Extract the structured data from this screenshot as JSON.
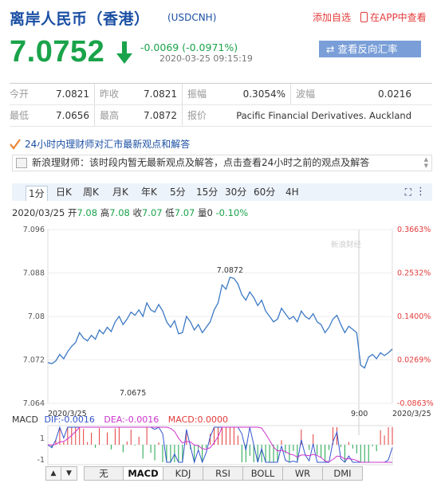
{
  "header": {
    "title": "离岸人民币（香港）",
    "code": "(USDCNH)",
    "add_watchlist": "添加自选",
    "app_view": "在APP中查看"
  },
  "quote": {
    "price": "7.0752",
    "direction": "down",
    "change": "-0.0069 (-0.0971%)",
    "timestamp": "2020-03-25 09:15:19",
    "reverse_button": "查看反向汇率"
  },
  "stats": {
    "row1": [
      {
        "label": "今开",
        "value": "7.0821"
      },
      {
        "label": "昨收",
        "value": "7.0821"
      },
      {
        "label": "振幅",
        "value": "0.3054%"
      },
      {
        "label": "波幅",
        "value": "0.0216"
      }
    ],
    "row2": [
      {
        "label": "最低",
        "value": "7.0656"
      },
      {
        "label": "最高",
        "value": "7.0872"
      },
      {
        "label": "报价",
        "value": "Pacific Financial Derivatives. Auckland"
      }
    ]
  },
  "commentary": {
    "banner": "24小时内理财师对汇市最新观点和解答",
    "text": "新浪理财师：该时段内暂无最新观点及解答，点击查看24小时之前的观点及解答"
  },
  "period_tabs": [
    "1分",
    "日K",
    "周K",
    "月K",
    "年K",
    "5分",
    "15分",
    "30分",
    "60分",
    "4H"
  ],
  "period_active": "1分",
  "ohlc": {
    "date": "2020/03/25",
    "open_label": "开",
    "open": "7.08",
    "high_label": "高",
    "high": "7.08",
    "close_label": "收",
    "close": "7.07",
    "low_label": "低",
    "low": "7.07",
    "vol_label": "量",
    "vol": "0",
    "change_pct": "-0.10%"
  },
  "chart_data": {
    "type": "line",
    "y_ticks_left": [
      "7.096",
      "7.088",
      "7.08",
      "7.072",
      "7.064"
    ],
    "y_ticks_right": [
      "0.3663%",
      "0.2532%",
      "0.1400%",
      "0.0269%",
      "-0.0863%"
    ],
    "ylim": [
      7.064,
      7.096
    ],
    "x_labels": [
      "2020/3/25",
      "9:00",
      "2020/3/25"
    ],
    "annotation_high": "7.0872",
    "annotation_low": "7.0675",
    "watermark": "新浪财经",
    "series": [
      {
        "values": [
          7.0715,
          7.0713,
          7.0718,
          7.073,
          7.0722,
          7.0735,
          7.0745,
          7.0752,
          7.077,
          7.076,
          7.0755,
          7.0765,
          7.0758,
          7.0775,
          7.0768,
          7.078,
          7.0772,
          7.079,
          7.08,
          7.0785,
          7.0795,
          7.0808,
          7.0802,
          7.0812,
          7.08,
          7.0825,
          7.0812,
          7.0808,
          7.0822,
          7.081,
          7.079,
          7.078,
          7.0792,
          7.0768,
          7.077,
          7.08,
          7.079,
          7.0775,
          7.0785,
          7.077,
          7.078,
          7.079,
          7.0812,
          7.0825,
          7.0858,
          7.085,
          7.0872,
          7.087,
          7.086,
          7.084,
          7.083,
          7.0845,
          7.0835,
          7.082,
          7.083,
          7.081,
          7.08,
          7.079,
          7.0795,
          7.0815,
          7.0805,
          7.0795,
          7.08,
          7.079,
          7.081,
          7.08,
          7.0795,
          7.0805,
          7.079,
          7.0785,
          7.077,
          7.078,
          7.0795,
          7.0802,
          7.0785,
          7.077,
          7.0782,
          7.0776,
          7.077,
          7.071,
          7.0705,
          7.0725,
          7.073,
          7.0722,
          7.0733,
          7.0728,
          7.0733,
          7.074
        ]
      }
    ]
  },
  "macd": {
    "label": "MACD",
    "dif_label": "DIF:",
    "dif": "-0.0016",
    "dea_label": "DEA:",
    "dea": "-0.0016",
    "macd_label": "MACD:",
    "macd_value": "0.0000",
    "y_ticks": [
      "1",
      "-1"
    ],
    "colors": {
      "dif": "#3355cc",
      "dea": "#cc33cc",
      "macd": "#e23b3b"
    }
  },
  "indicator_tabs": [
    "无",
    "MACD",
    "KDJ",
    "RSI",
    "BOLL",
    "WR",
    "DMI"
  ],
  "indicator_active": "MACD",
  "colors": {
    "down": "#1aa34a",
    "up": "#e23b3b",
    "brand": "#1a4fa3",
    "line": "#3b79c4"
  }
}
